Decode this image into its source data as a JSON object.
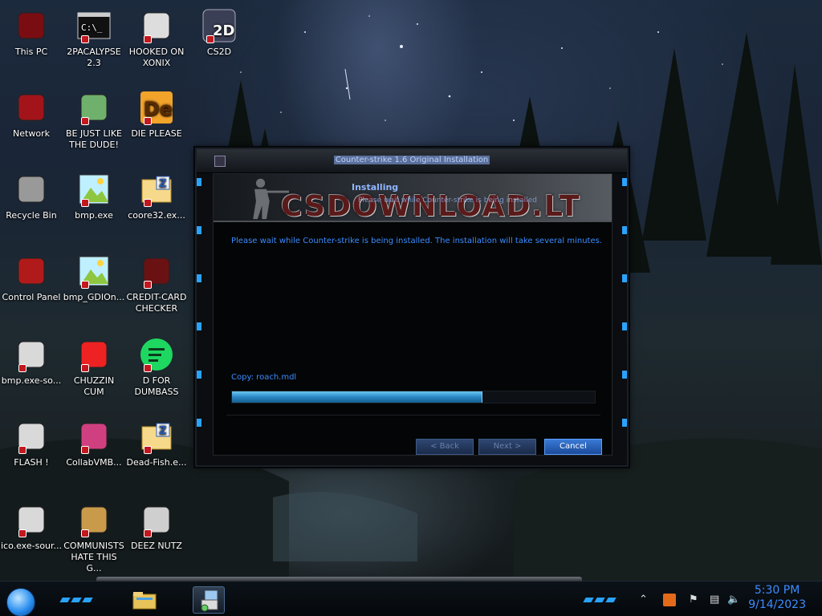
{
  "desktop": {
    "icons": [
      {
        "label": "This PC",
        "icon": "computer-icon"
      },
      {
        "label": "2PACALYPSE 2.3",
        "icon": "terminal-icon"
      },
      {
        "label": "HOOKED ON XONIX",
        "icon": "game-icon"
      },
      {
        "label": "CS2D",
        "icon": "gun-icon"
      },
      {
        "label": "Network",
        "icon": "network-icon"
      },
      {
        "label": "BE JUST LIKE THE DUDE!",
        "icon": "santa-icon"
      },
      {
        "label": "DIE PLEASE",
        "icon": "de-icon"
      },
      {
        "label": "Recycle Bin",
        "icon": "trash-icon"
      },
      {
        "label": "bmp.exe",
        "icon": "image-icon"
      },
      {
        "label": "coore32.ex...",
        "icon": "zip-folder-icon"
      },
      {
        "label": "Control Panel",
        "icon": "control-panel-icon"
      },
      {
        "label": "bmp_GDIOn...",
        "icon": "image-icon"
      },
      {
        "label": "CREDIT-CARD CHECKER",
        "icon": "card-reader-icon"
      },
      {
        "label": "bmp.exe-so...",
        "icon": "file-icon"
      },
      {
        "label": "CHUZZIN CUM",
        "icon": "chuzzle-icon"
      },
      {
        "label": "D FOR DUMBASS",
        "icon": "spotify-icon"
      },
      {
        "label": "FLASH !",
        "icon": "file-icon"
      },
      {
        "label": "CollabVMB...",
        "icon": "monitor-icon"
      },
      {
        "label": "Dead-Fish.e...",
        "icon": "zip-folder-icon"
      },
      {
        "label": "ico.exe-sour...",
        "icon": "file-icon"
      },
      {
        "label": "COMMUNISTS HATE THIS G...",
        "icon": "money-bag-icon"
      },
      {
        "label": "DEEZ NUTZ",
        "icon": "windows-stack-icon"
      }
    ]
  },
  "installer": {
    "title": "Counter-strike 1.6 Original Installation",
    "brand": "CSDOWNLOAD.LT",
    "heading": "Installing",
    "subheading": "Please wait while Counter-strike is being installed",
    "message": "Please wait while Counter-strike is being installed. The installation will take several minutes.",
    "status": "Copy: roach.mdl",
    "progress": 0.69,
    "buttons": {
      "back": "< Back",
      "next": "Next >",
      "cancel": "Cancel"
    }
  },
  "taskbar": {
    "clock_time": "5:30 PM",
    "clock_date": "9/14/2023"
  }
}
